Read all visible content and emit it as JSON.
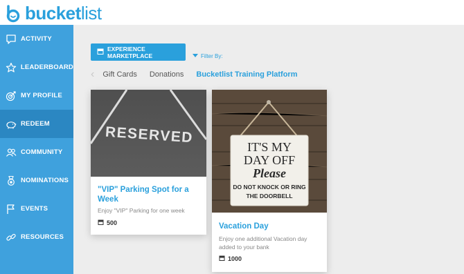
{
  "app": {
    "brand_bold": "bucket",
    "brand_light": "list"
  },
  "sidebar": {
    "items": [
      {
        "label": "ACTIVITY",
        "icon": "chat-bubble-icon"
      },
      {
        "label": "LEADERBOARD",
        "icon": "star-icon"
      },
      {
        "label": "MY PROFILE",
        "icon": "target-icon"
      },
      {
        "label": "REDEEM",
        "icon": "piggy-bank-icon"
      },
      {
        "label": "COMMUNITY",
        "icon": "people-icon"
      },
      {
        "label": "NOMINATIONS",
        "icon": "medal-icon"
      },
      {
        "label": "EVENTS",
        "icon": "flag-icon"
      },
      {
        "label": "RESOURCES",
        "icon": "link-icon"
      }
    ],
    "active": "REDEEM"
  },
  "toolbar": {
    "marketplace_label": "EXPERIENCE MARKETPLACE",
    "filter_label": "Filter By:"
  },
  "categories": {
    "items": [
      "Gift Cards",
      "Donations",
      "Bucketlist Training Platform"
    ],
    "selected": "Bucketlist Training Platform"
  },
  "rewards": [
    {
      "title": "\"VIP\" Parking Spot for a Week",
      "description": "Enjoy \"VIP\" Parking for one week",
      "cost": "500",
      "image_text": "RESERVED"
    },
    {
      "title": "Vacation Day",
      "description": "Enjoy one additional Vacation day added to your bank",
      "cost": "1000",
      "image_text": {
        "line1": "IT'S MY",
        "line2": "DAY OFF",
        "line3": "Please",
        "line4": "DO NOT KNOCK OR RING",
        "line5": "THE DOORBELL"
      }
    }
  ],
  "colors": {
    "accent": "#2aa0dc",
    "sidebar": "#3fa1dd",
    "sidebar_active": "#2b87c2"
  }
}
